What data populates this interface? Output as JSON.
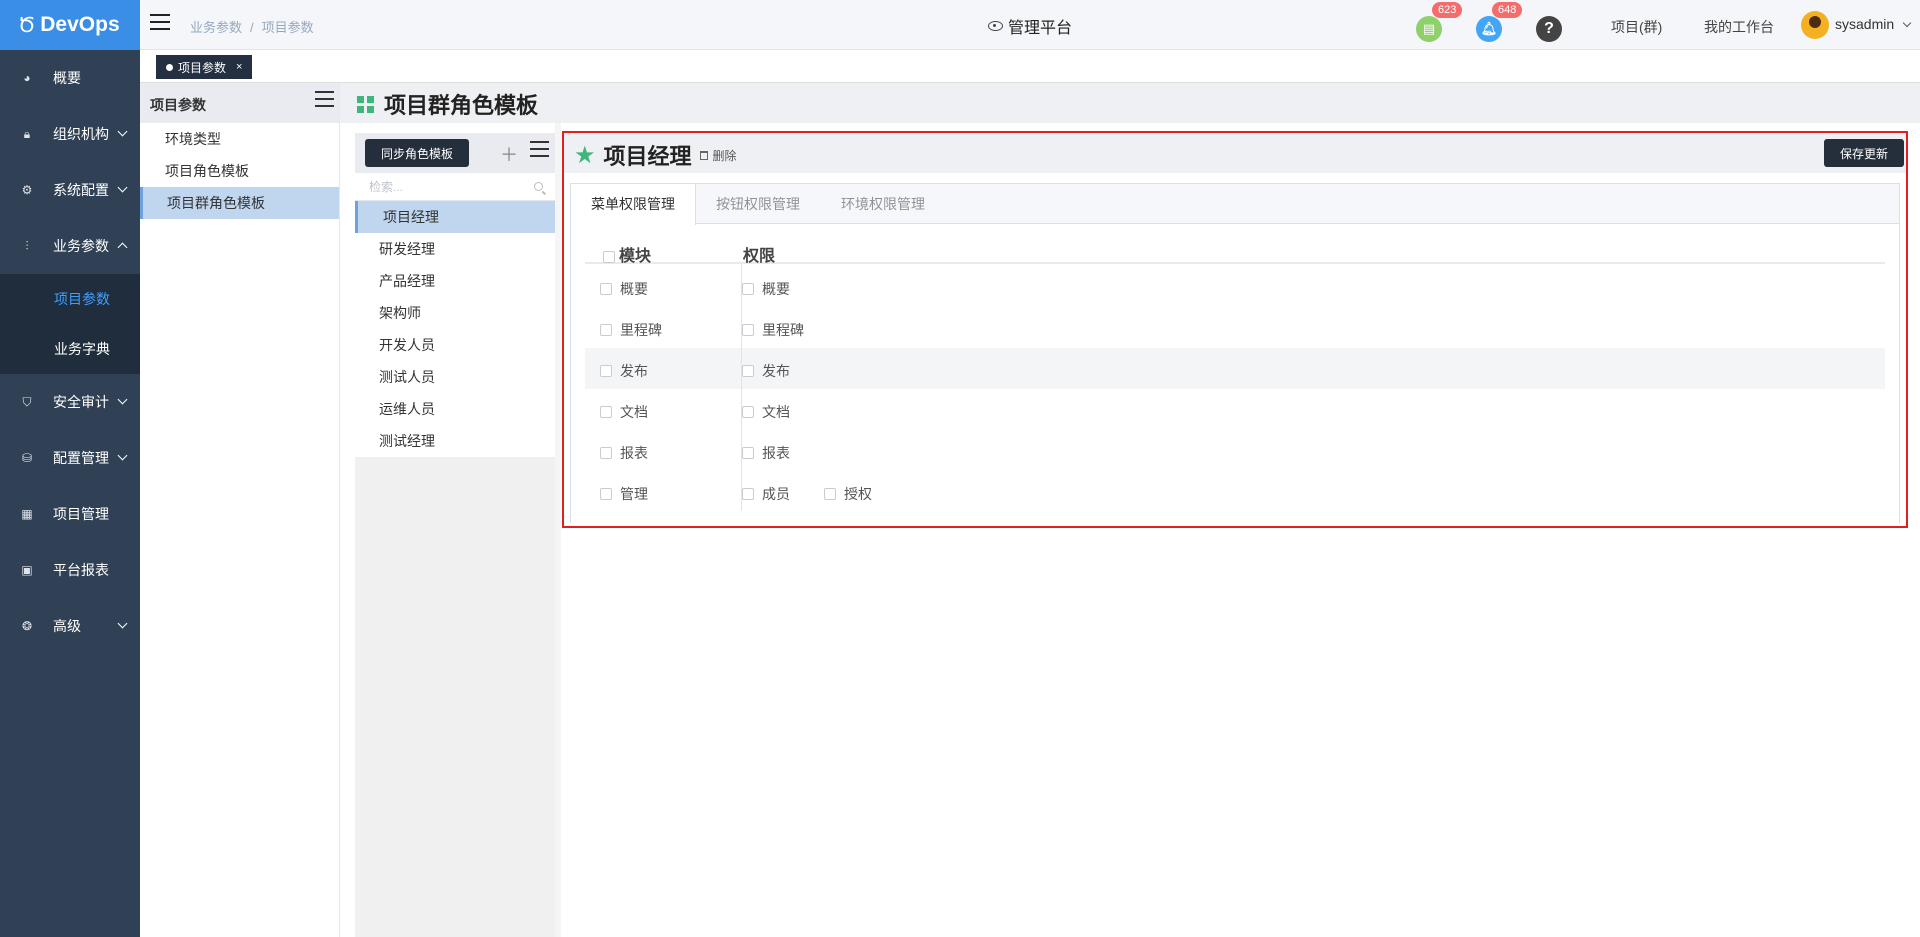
{
  "app": {
    "logo": "DevOps"
  },
  "header": {
    "breadcrumb": [
      "业务参数",
      "项目参数"
    ],
    "breadcrumb_sep": "/",
    "platform": "管理平台",
    "badges": {
      "tasks": "623",
      "notifications": "648"
    },
    "help_icon": "?",
    "links": [
      "项目(群)",
      "我的工作台"
    ],
    "user": "sysadmin"
  },
  "visited_tab": {
    "label": "项目参数",
    "close": "×"
  },
  "sidebar": {
    "items": [
      {
        "label": "概要",
        "icon": "dashboard-icon"
      },
      {
        "label": "组织机构",
        "icon": "lock-icon"
      },
      {
        "label": "系统配置",
        "icon": "gear-icon"
      },
      {
        "label": "业务参数",
        "icon": "sliders-icon",
        "expanded": true
      },
      {
        "label": "项目参数"
      },
      {
        "label": "业务字典"
      },
      {
        "label": "安全审计",
        "icon": "shield-icon"
      },
      {
        "label": "配置管理",
        "icon": "database-icon"
      },
      {
        "label": "项目管理",
        "icon": "grid-icon"
      },
      {
        "label": "平台报表",
        "icon": "monitor-icon"
      },
      {
        "label": "高级",
        "icon": "advanced-icon"
      }
    ]
  },
  "category_panel": {
    "title": "项目参数",
    "items": [
      "环境类型",
      "项目角色模板",
      "项目群角色模板"
    ],
    "selected": "项目群角色模板"
  },
  "page_title": "项目群角色模板",
  "role_panel": {
    "sync_button": "同步角色模板",
    "add_icon": "＋",
    "search_placeholder": "检索...",
    "roles": [
      "项目经理",
      "研发经理",
      "产品经理",
      "架构师",
      "开发人员",
      "测试人员",
      "运维人员",
      "测试经理"
    ],
    "selected": "项目经理"
  },
  "detail": {
    "title": "项目经理",
    "delete_label": "删除",
    "save_button": "保存更新",
    "tabs": [
      "菜单权限管理",
      "按钮权限管理",
      "环境权限管理"
    ],
    "active_tab": "菜单权限管理",
    "col_module": "模块",
    "col_permission": "权限",
    "rows": [
      {
        "module": "概要",
        "permissions": [
          "概要"
        ]
      },
      {
        "module": "里程碑",
        "permissions": [
          "里程碑"
        ]
      },
      {
        "module": "发布",
        "permissions": [
          "发布"
        ]
      },
      {
        "module": "文档",
        "permissions": [
          "文档"
        ]
      },
      {
        "module": "报表",
        "permissions": [
          "报表"
        ]
      },
      {
        "module": "管理",
        "permissions": [
          "成员",
          "授权"
        ]
      }
    ]
  },
  "colors": {
    "primary": "#3a8ee6",
    "sidebar": "#304156",
    "highlight": "#e02020",
    "accent_green": "#3eb67c"
  }
}
